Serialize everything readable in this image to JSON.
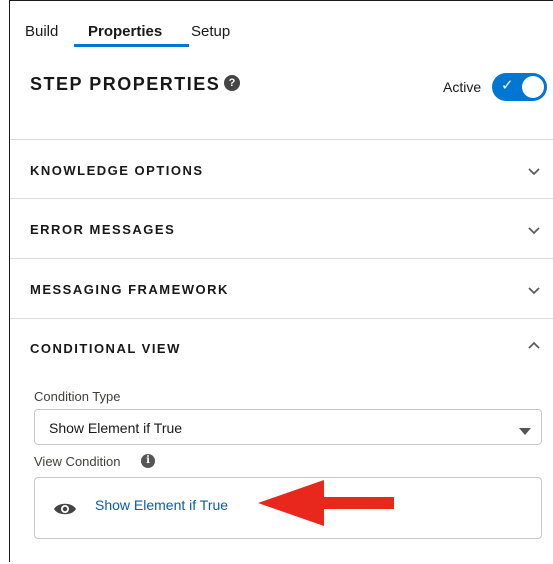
{
  "tabs": [
    {
      "label": "Build"
    },
    {
      "label": "Properties",
      "active": true
    },
    {
      "label": "Setup"
    }
  ],
  "header": {
    "title": "STEP PROPERTIES",
    "help_icon": "?",
    "active_label": "Active",
    "toggle_on": true
  },
  "sections": [
    {
      "title": "KNOWLEDGE OPTIONS",
      "expanded": false
    },
    {
      "title": "ERROR MESSAGES",
      "expanded": false
    },
    {
      "title": "MESSAGING FRAMEWORK",
      "expanded": false
    },
    {
      "title": "CONDITIONAL VIEW",
      "expanded": true
    }
  ],
  "conditional_view": {
    "condition_type_label": "Condition Type",
    "condition_type_value": "Show Element if True",
    "view_condition_label": "View Condition",
    "info_icon": "i",
    "view_condition_link": "Show Element if True"
  },
  "colors": {
    "accent": "#0176d3",
    "link": "#0b5cab",
    "annotation_arrow": "#e8281c"
  },
  "icons": [
    "help-icon",
    "check-icon",
    "chevron-down-icon",
    "chevron-up-icon",
    "caret-down-icon",
    "info-icon",
    "eye-icon",
    "arrow-left-icon"
  ]
}
